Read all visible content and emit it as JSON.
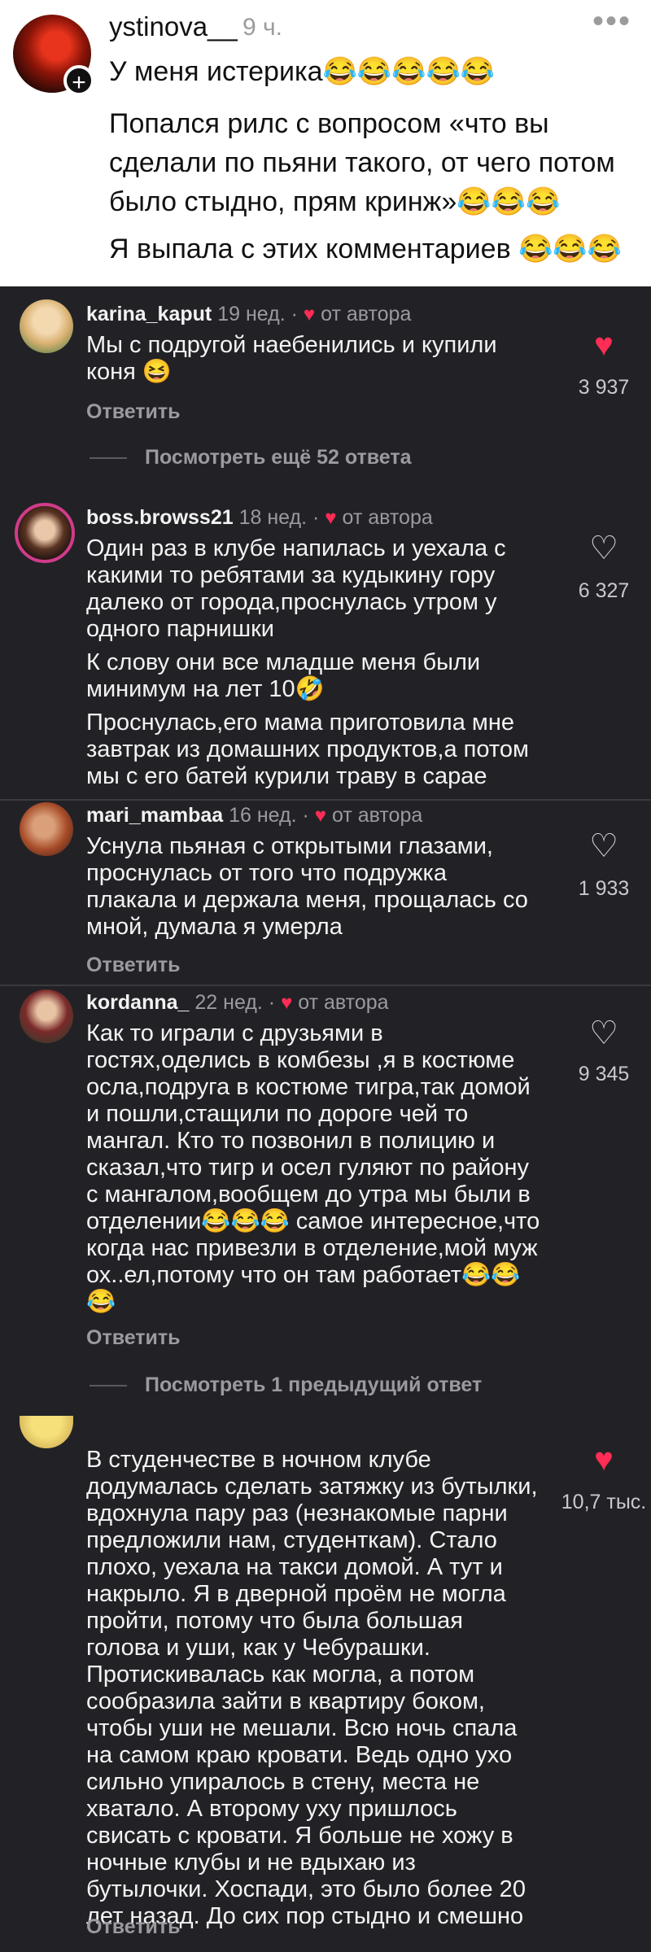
{
  "post": {
    "username": "ystinova__",
    "time": "9 ч.",
    "menu_icon": "more-dots-icon",
    "line1": "У меня истерика😂😂😂😂😂",
    "line2": "Попался рилс с вопросом «что вы сделали по пьяни такого, от чего потом было стыдно, прям кринж»😂😂😂",
    "line3": "Я выпала с этих комментариев 😂😂😂"
  },
  "comments": [
    {
      "username": "karina_kaput",
      "ago": "19 нед.",
      "author_note": "от автора",
      "text": "Мы с подругой наебенились и купили коня 😆",
      "likes": "3 937",
      "liked": true,
      "reply_label": "Ответить",
      "more_replies": "Посмотреть ещё 52 ответа"
    },
    {
      "username": "boss.browss21",
      "ago": "18 нед.",
      "author_note": "от автора",
      "text": "Один раз в клубе напилась и уехала с какими то ребятами за кудыкину гору далеко от города,проснулась утром у одного парнишки",
      "text2": "К слову они все младше меня были минимум на лет 10🤣",
      "text3": "Проснулась,его мама приготовила мне завтрак из домашних продуктов,а потом мы с его батей курили траву в сарае",
      "likes": "6 327",
      "liked": false
    },
    {
      "username": "mari_mambaa",
      "ago": "16 нед.",
      "author_note": "от автора",
      "text": "Уснула пьяная с открытыми глазами, проснулась от того что подружка плакала и держала меня, прощалась со мной, думала я умерла",
      "likes": "1 933",
      "liked": false,
      "reply_label": "Ответить"
    },
    {
      "username": "kordanna_",
      "ago": "22 нед.",
      "author_note": "от автора",
      "text": "Как то играли с друзьями в гостях,оделись в комбезы ,я в костюме осла,подруга в костюме тигра,так домой и пошли,стащили по дороге чей то мангал. Кто то позвонил в полицию и сказал,что тигр и осел гуляют по району с мангалом,вообщем до утра мы были в отделении😂😂😂 самое интересное,что когда нас привезли в отделение,мой муж ох..ел,потому что он там работает😂😂😂",
      "likes": "9 345",
      "liked": false,
      "reply_label": "Ответить",
      "more_replies": "Посмотреть 1 предыдущий ответ"
    },
    {
      "text": "В студенчестве в ночном клубе додумалась сделать затяжку из бутылки, вдохнула пару раз (незнакомые парни предложили нам, студенткам). Стало плохо, уехала на такси домой. А тут и накрыло. Я в дверной проём не могла пройти, потому что была большая голова и уши, как у Чебурашки. Протискивалась как могла, а потом сообразила зайти в квартиру боком, чтобы уши не мешали. Всю ночь спала на самом краю кровати. Ведь одно ухо сильно упиралось в стену, места не хватало. А второму уху пришлось свисать с кровати. Я больше не хожу в ночные клубы и не вдыхаю из бутылочки. Хоспади, это было более 20 лет назад. До сих пор стыдно и смешно",
      "likes": "10,7 тыс.",
      "liked": true,
      "reply_label": "Ответить"
    }
  ],
  "colors": {
    "like_active": "#ff2d55",
    "background": "#222226"
  }
}
